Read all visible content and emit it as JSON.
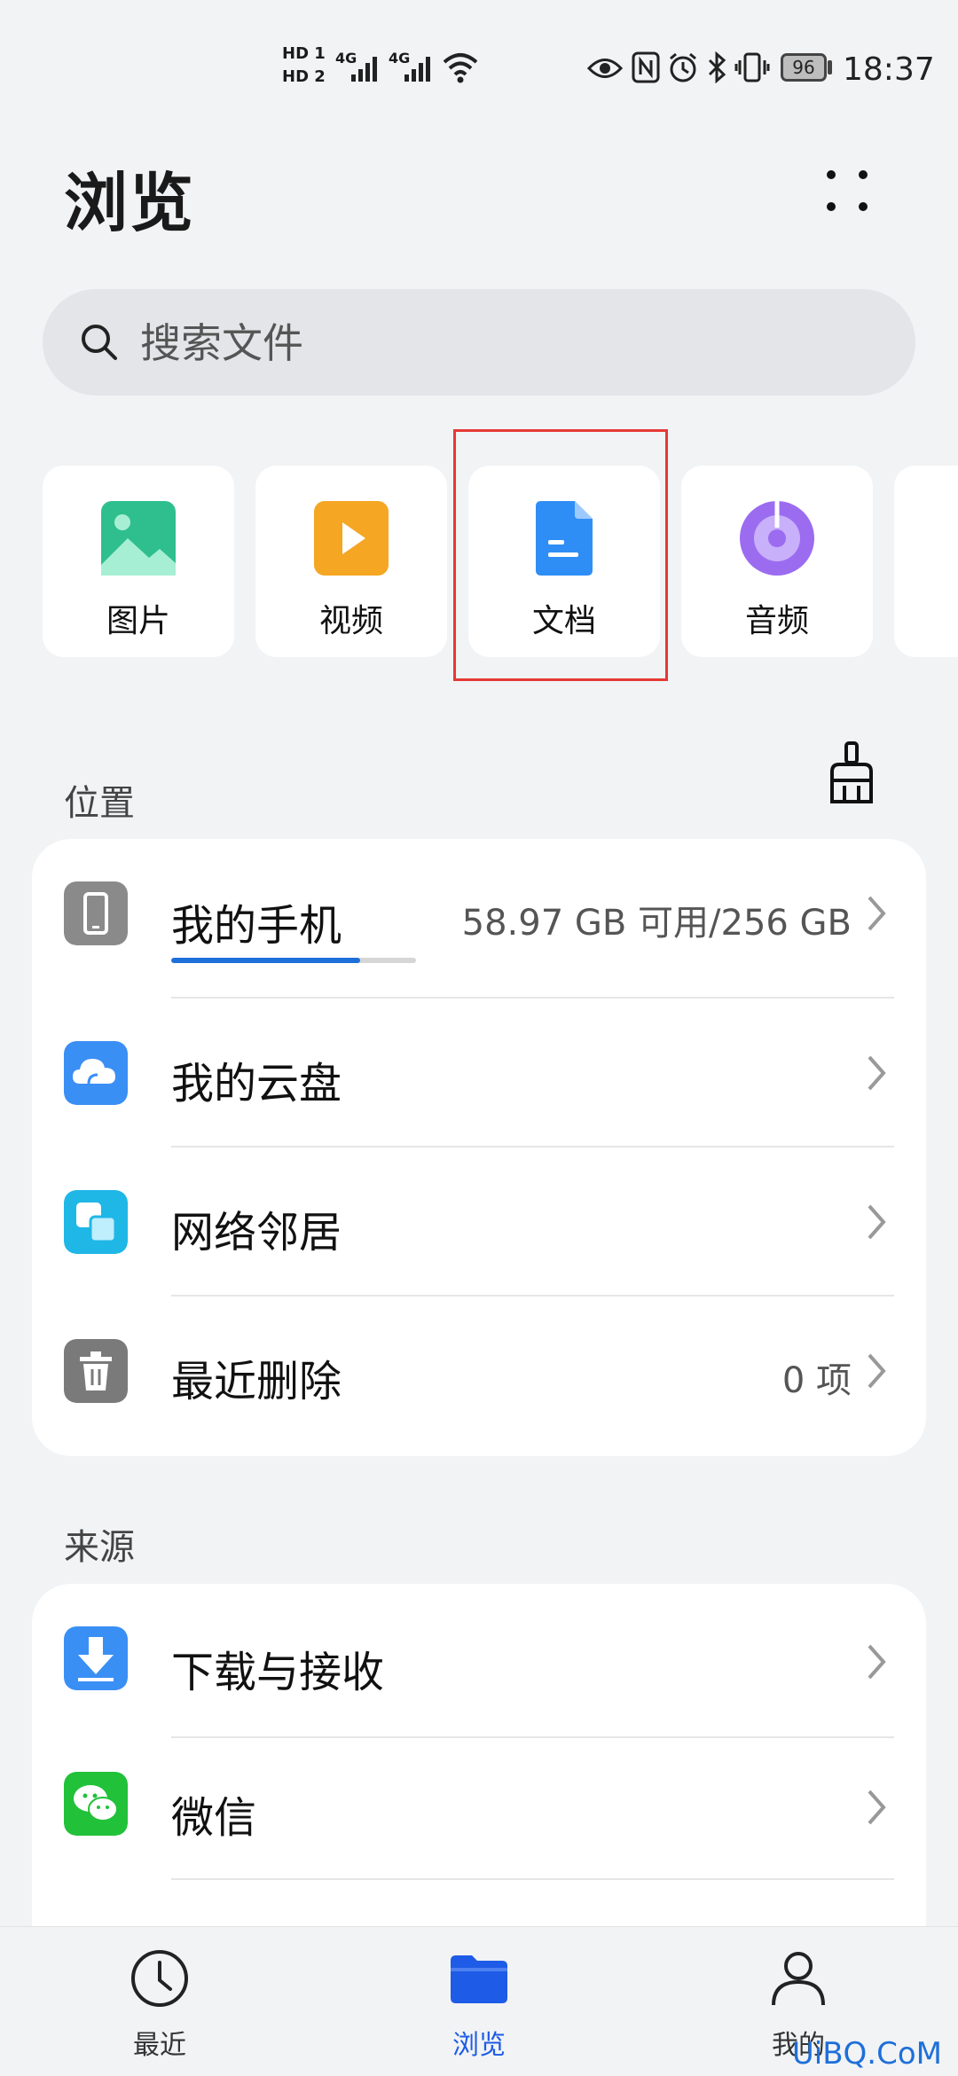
{
  "status_bar": {
    "sim1": "HD 1",
    "sim2": "HD 2",
    "net1": "4G",
    "net2": "4G",
    "battery": "96",
    "time": "18:37"
  },
  "header": {
    "title": "浏览"
  },
  "search": {
    "placeholder": "搜索文件"
  },
  "categories": [
    {
      "label": "图片",
      "icon": "image-icon",
      "color": "#2fbf8f"
    },
    {
      "label": "视频",
      "icon": "video-icon",
      "color": "#f5a623"
    },
    {
      "label": "文档",
      "icon": "document-icon",
      "color": "#2f8ef5"
    },
    {
      "label": "音频",
      "icon": "audio-icon",
      "color": "#9b6cf0"
    }
  ],
  "location": {
    "title": "位置",
    "items": [
      {
        "label": "我的手机",
        "value": "58.97 GB 可用/256 GB",
        "icon": "phone-icon",
        "color": "#8a8a8a",
        "storage_used_fraction": 0.77
      },
      {
        "label": "我的云盘",
        "value": "",
        "icon": "cloud-icon",
        "color": "#3a8ff5"
      },
      {
        "label": "网络邻居",
        "value": "",
        "icon": "network-icon",
        "color": "#1fb7e6"
      },
      {
        "label": "最近删除",
        "value": "0 项",
        "icon": "trash-icon",
        "color": "#7a7a7a"
      }
    ]
  },
  "source": {
    "title": "来源",
    "items": [
      {
        "label": "下载与接收",
        "icon": "download-icon",
        "color": "#3a8ff5"
      },
      {
        "label": "微信",
        "icon": "wechat-icon",
        "color": "#22c13a"
      }
    ]
  },
  "bottom_nav": [
    {
      "label": "最近",
      "icon": "clock-icon"
    },
    {
      "label": "浏览",
      "icon": "folder-icon",
      "active": true
    },
    {
      "label": "我的",
      "icon": "person-icon"
    }
  ],
  "watermark": "UiBQ.CoM"
}
